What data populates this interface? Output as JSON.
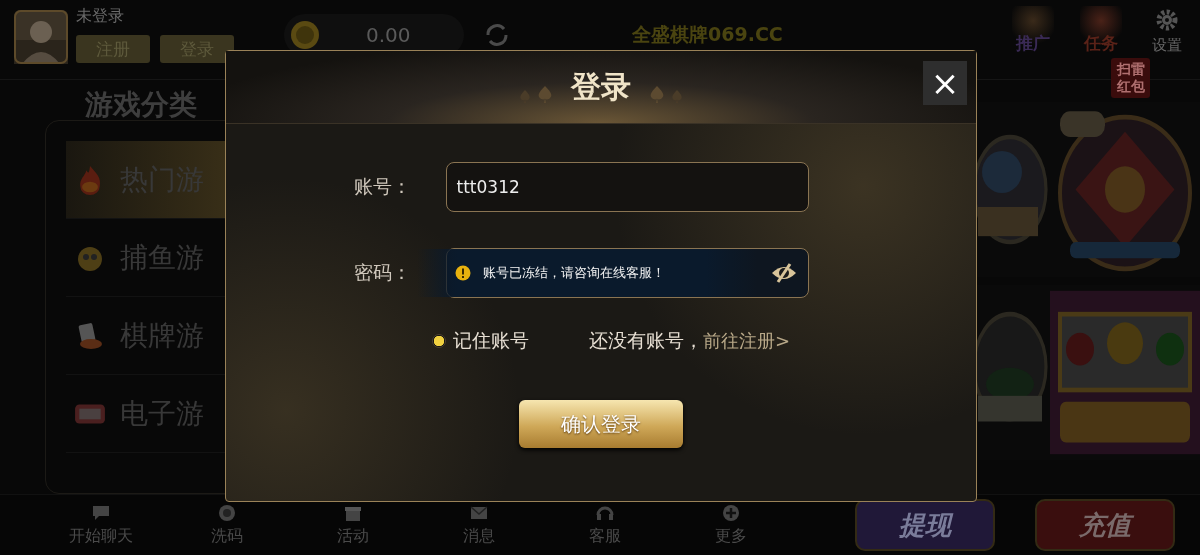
{
  "header": {
    "user_status": "未登录",
    "buttons": [
      {
        "label": "注册"
      },
      {
        "label": "登录"
      }
    ],
    "balance": "0.00",
    "site_title": "全盛棋牌069.CC",
    "shortcuts": [
      {
        "label": "推广"
      },
      {
        "label": "任务"
      },
      {
        "label": "设置"
      }
    ]
  },
  "categories": {
    "title": "游戏分类",
    "items": [
      {
        "label": "热门游",
        "selected": true
      },
      {
        "label": "捕鱼游",
        "selected": false
      },
      {
        "label": "棋牌游",
        "selected": false
      },
      {
        "label": "电子游",
        "selected": false
      }
    ]
  },
  "promo_badge": "扫雷红包",
  "bottom_nav": [
    {
      "label": "开始聊天"
    },
    {
      "label": "洗码"
    },
    {
      "label": "活动"
    },
    {
      "label": "消息"
    },
    {
      "label": "客服"
    },
    {
      "label": "更多"
    }
  ],
  "action_buttons": [
    {
      "label": "提现"
    },
    {
      "label": "充值"
    }
  ],
  "login_dialog": {
    "title": "登录",
    "close": "×",
    "account_label": "账号：",
    "account_value": "ttt0312",
    "password_label": "密码：",
    "toast": "账号已冻结，请咨询在线客服！",
    "remember": {
      "label": "记住账号",
      "checked": true
    },
    "register_prompt": "还没有账号，",
    "register_link": "前往注册>",
    "submit": "确认登录"
  }
}
